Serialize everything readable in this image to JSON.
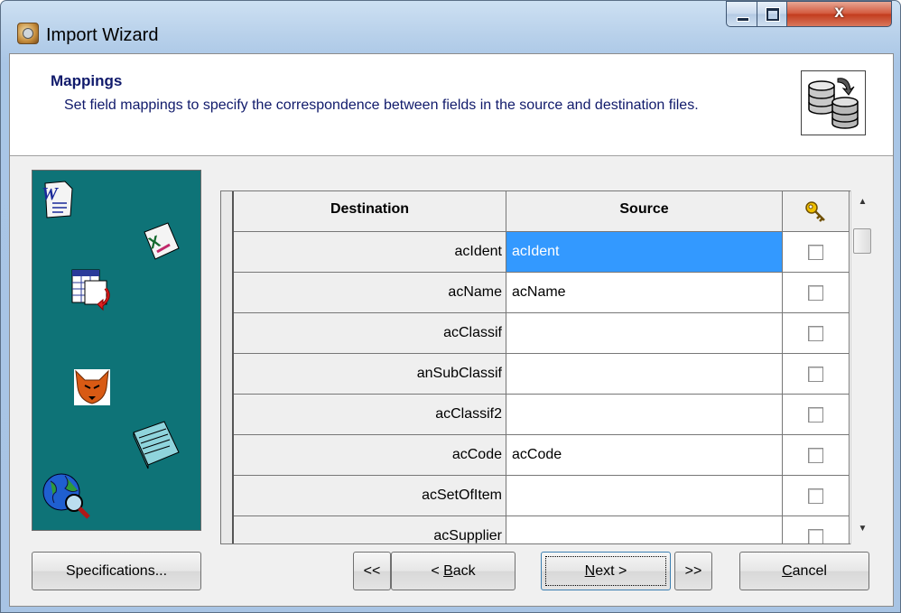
{
  "window": {
    "title": "Import Wizard",
    "close_glyph": "x"
  },
  "header": {
    "title": "Mappings",
    "description": "Set field mappings to specify the correspondence between fields in the source and destination files."
  },
  "grid": {
    "columns": [
      "Destination",
      "Source",
      "key-icon"
    ],
    "rows": [
      {
        "destination": "acIdent",
        "source": "acIdent",
        "key": false,
        "selected": true
      },
      {
        "destination": "acName",
        "source": "acName",
        "key": false,
        "selected": false
      },
      {
        "destination": "acClassif",
        "source": "",
        "key": false,
        "selected": false
      },
      {
        "destination": "anSubClassif",
        "source": "",
        "key": false,
        "selected": false
      },
      {
        "destination": "acClassif2",
        "source": "",
        "key": false,
        "selected": false
      },
      {
        "destination": "acCode",
        "source": "acCode",
        "key": false,
        "selected": false
      },
      {
        "destination": "acSetOfItem",
        "source": "",
        "key": false,
        "selected": false
      },
      {
        "destination": "acSupplier",
        "source": "",
        "key": false,
        "selected": false
      }
    ]
  },
  "buttons": {
    "specifications": "Specifications...",
    "first": "<<",
    "back_prefix": "< ",
    "back_mnemonic": "B",
    "back_rest": "ack",
    "next_mnemonic": "N",
    "next_rest": "ext >",
    "last": ">>",
    "cancel_mnemonic": "C",
    "cancel_rest": "ancel"
  },
  "colors": {
    "side_panel": "#0e7377",
    "selection": "#3399ff",
    "header_text": "#101a6b"
  }
}
